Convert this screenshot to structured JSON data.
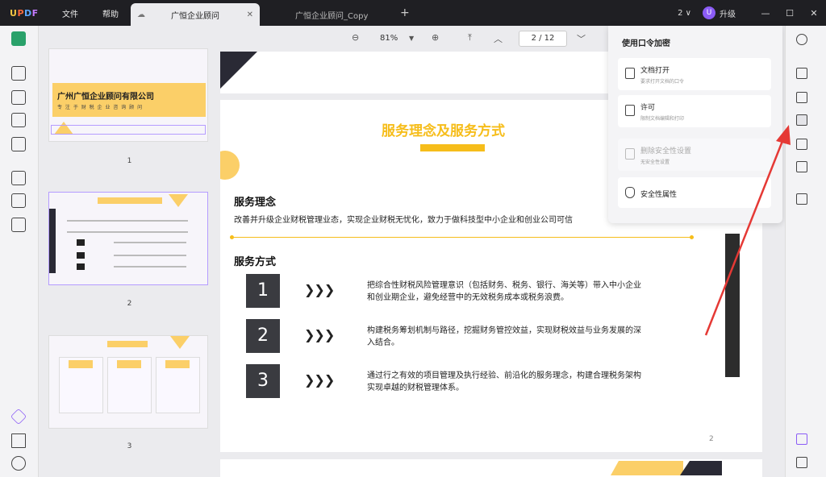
{
  "app": {
    "logo": "UPDF"
  },
  "menu": {
    "file": "文件",
    "help": "帮助"
  },
  "tabs": [
    {
      "label": "广恒企业顾问",
      "active": true
    },
    {
      "label": "广恒企业顾问_Copy",
      "active": false
    }
  ],
  "titlebar": {
    "count": "2",
    "chevron": "∨",
    "upgrade_badge": "U",
    "upgrade": "升级"
  },
  "toolbar": {
    "zoom": "81%",
    "page": "2 / 12"
  },
  "thumbnails": {
    "t1_title": "广州广恒企业顾问有限公司",
    "t1_sub": "专 注 于 财 税 企 业 咨 询 顾 问",
    "numbers": [
      "1",
      "2",
      "3"
    ]
  },
  "page": {
    "heading": "服务理念及服务方式",
    "sec1_title": "服务理念",
    "sec1_text": "改善并升级企业财税管理业态，实现企业财税无忧化，致力于做科技型中小企业和创业公司可信",
    "sec2_title": "服务方式",
    "items": [
      {
        "num": "1",
        "text": "把综合性财税风险管理意识（包括财务、税务、银行、海关等）带入中小企业和创业期企业，避免经营中的无效税务成本或税务浪费。"
      },
      {
        "num": "2",
        "text": "构建税务筹划机制与路径，挖掘财务管控效益，实现财税效益与业务发展的深入结合。"
      },
      {
        "num": "3",
        "text": "通过行之有效的项目管理及执行经验、前沿化的服务理念，构建合理税务架构实现卓越的财税管理体系。"
      }
    ],
    "arrows": "❯❯❯",
    "page_number": "2"
  },
  "security_panel": {
    "title": "使用口令加密",
    "options": [
      {
        "title": "文档打开",
        "desc": "要求打开文档的口令",
        "enabled": true
      },
      {
        "title": "许可",
        "desc": "限制文档编辑和打印",
        "enabled": true
      },
      {
        "title": "删除安全性设置",
        "desc": "无安全性设置",
        "enabled": false
      },
      {
        "title": "安全性属性",
        "desc": "",
        "enabled": true
      }
    ]
  },
  "colors": {
    "accent_yellow": "#f6bd1a",
    "dark": "#3a3b40",
    "arrow_red": "#e53935",
    "purple": "#8b5cf6"
  }
}
